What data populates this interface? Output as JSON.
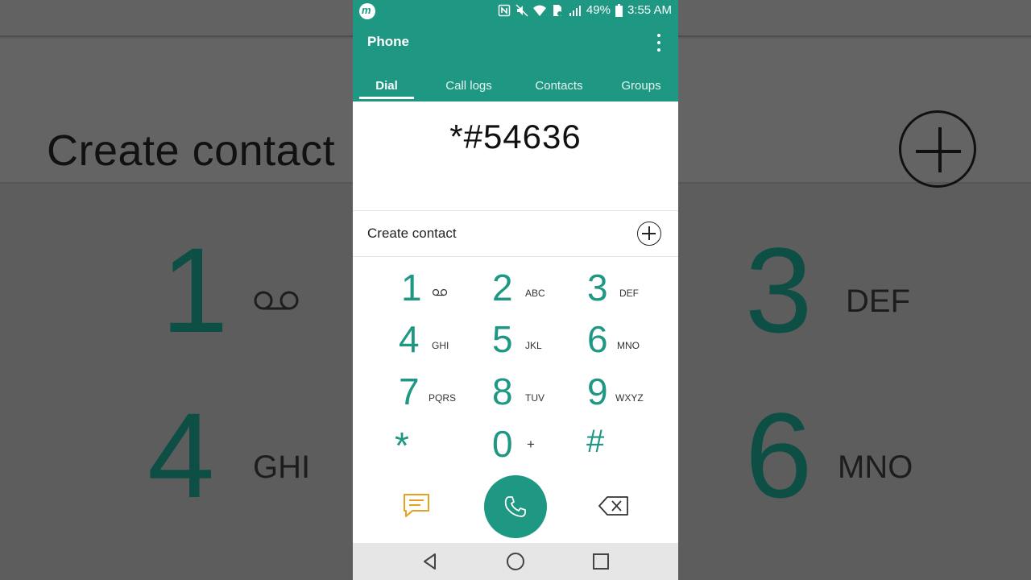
{
  "background": {
    "create_label": "Create contact",
    "digits": [
      {
        "digit": "1",
        "letters": ""
      },
      {
        "digit": "3",
        "letters": "DEF"
      },
      {
        "digit": "4",
        "letters": "GHI"
      },
      {
        "digit": "6",
        "letters": "MNO"
      }
    ]
  },
  "status_bar": {
    "battery": "49%",
    "time": "3:55 AM"
  },
  "app_bar": {
    "title": "Phone",
    "tabs": [
      {
        "label": "Dial",
        "active": true
      },
      {
        "label": "Call logs",
        "active": false
      },
      {
        "label": "Contacts",
        "active": false
      },
      {
        "label": "Groups",
        "active": false
      }
    ]
  },
  "dialer": {
    "number": "*#54636",
    "create_contact_label": "Create contact",
    "keys": [
      {
        "digit": "1",
        "letters": ""
      },
      {
        "digit": "2",
        "letters": "ABC"
      },
      {
        "digit": "3",
        "letters": "DEF"
      },
      {
        "digit": "4",
        "letters": "GHI"
      },
      {
        "digit": "5",
        "letters": "JKL"
      },
      {
        "digit": "6",
        "letters": "MNO"
      },
      {
        "digit": "7",
        "letters": "PQRS"
      },
      {
        "digit": "8",
        "letters": "TUV"
      },
      {
        "digit": "9",
        "letters": "WXYZ"
      },
      {
        "digit": "*",
        "letters": ""
      },
      {
        "digit": "0",
        "letters": "+"
      },
      {
        "digit": "#",
        "letters": ""
      }
    ]
  },
  "colors": {
    "accent": "#1e9783",
    "message_icon": "#e8a020"
  },
  "icons": {
    "message": "message-icon",
    "call": "phone-call-icon",
    "delete": "backspace-icon",
    "voicemail": "voicemail-icon"
  }
}
